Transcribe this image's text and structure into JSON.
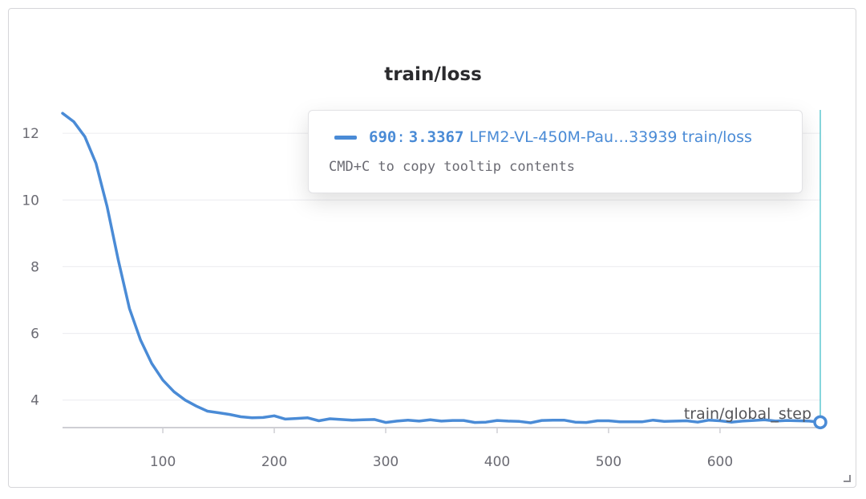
{
  "chart_data": {
    "type": "line",
    "title": "train/loss",
    "xlabel": "train/global_step",
    "ylabel": "",
    "xlim": [
      10,
      690
    ],
    "ylim": [
      3.2,
      12.7
    ],
    "xticks": [
      100,
      200,
      300,
      400,
      500,
      600
    ],
    "yticks": [
      4,
      6,
      8,
      10,
      12
    ],
    "grid": true,
    "series": [
      {
        "name": "LFM2-VL-450M-Pau…33939 train/loss",
        "color": "#4a8bd6",
        "x": [
          10,
          20,
          30,
          40,
          50,
          60,
          70,
          80,
          90,
          100,
          110,
          120,
          130,
          140,
          150,
          160,
          170,
          180,
          190,
          200,
          210,
          220,
          230,
          240,
          250,
          260,
          270,
          280,
          290,
          300,
          310,
          320,
          330,
          340,
          350,
          360,
          370,
          380,
          390,
          400,
          410,
          420,
          430,
          440,
          450,
          460,
          470,
          480,
          490,
          500,
          510,
          520,
          530,
          540,
          550,
          560,
          570,
          580,
          590,
          600,
          610,
          620,
          630,
          640,
          650,
          660,
          670,
          680,
          690
        ],
        "y": [
          12.6,
          12.35,
          11.9,
          11.1,
          9.8,
          8.2,
          6.75,
          5.8,
          5.1,
          4.6,
          4.25,
          4.0,
          3.82,
          3.67,
          3.62,
          3.57,
          3.5,
          3.47,
          3.48,
          3.53,
          3.43,
          3.45,
          3.47,
          3.38,
          3.44,
          3.42,
          3.4,
          3.41,
          3.42,
          3.33,
          3.37,
          3.4,
          3.37,
          3.41,
          3.37,
          3.39,
          3.39,
          3.33,
          3.34,
          3.39,
          3.37,
          3.36,
          3.32,
          3.39,
          3.4,
          3.4,
          3.34,
          3.33,
          3.38,
          3.38,
          3.35,
          3.35,
          3.35,
          3.4,
          3.36,
          3.37,
          3.38,
          3.34,
          3.4,
          3.38,
          3.34,
          3.37,
          3.39,
          3.41,
          3.37,
          3.39,
          3.38,
          3.37,
          3.3367
        ]
      }
    ]
  },
  "tooltip": {
    "step": "690",
    "colon": ":",
    "value": "3.3367",
    "series_name": "LFM2-VL-450M-Pau…33939 train/loss",
    "hint": "CMD+C to copy tooltip contents"
  },
  "colors": {
    "line": "#4a8bd6",
    "crosshair": "#5ec8d0",
    "grid": "#ececef",
    "axis": "#cfcfd4"
  }
}
